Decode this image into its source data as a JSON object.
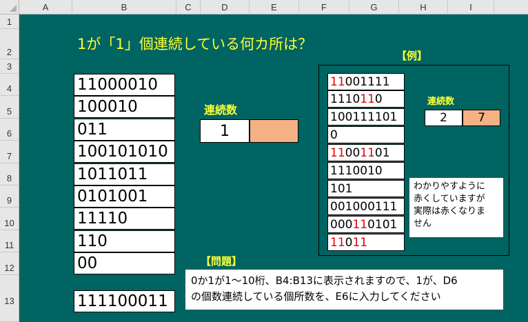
{
  "columns": [
    "A",
    "B",
    "C",
    "D",
    "E",
    "F",
    "G",
    "H",
    "I"
  ],
  "rows": [
    "1",
    "2",
    "3",
    "4",
    "5",
    "6",
    "7",
    "8",
    "9",
    "10",
    "11",
    "12",
    "13"
  ],
  "title": "1が「1」個連続している何カ所は？",
  "input": {
    "label": "連続数",
    "d6_value": "1",
    "e6_value": ""
  },
  "b_values": [
    "11000010",
    "100010",
    "011",
    "100101010",
    "1011011",
    "0101001",
    "11110",
    "110",
    "00",
    "111100011"
  ],
  "example": {
    "label": "【例】",
    "rows": [
      [
        {
          "t": "11",
          "r": true
        },
        {
          "t": "001111",
          "r": false
        }
      ],
      [
        {
          "t": "1110",
          "r": false
        },
        {
          "t": "11",
          "r": true
        },
        {
          "t": "0",
          "r": false
        }
      ],
      [
        {
          "t": "100111101",
          "r": false
        }
      ],
      [
        {
          "t": "0",
          "r": false
        }
      ],
      [
        {
          "t": "11",
          "r": true
        },
        {
          "t": "00",
          "r": false
        },
        {
          "t": "11",
          "r": true
        },
        {
          "t": "01",
          "r": false
        }
      ],
      [
        {
          "t": "1110010",
          "r": false
        }
      ],
      [
        {
          "t": "101",
          "r": false
        }
      ],
      [
        {
          "t": "001000111",
          "r": false
        }
      ],
      [
        {
          "t": "000",
          "r": false
        },
        {
          "t": "11",
          "r": true
        },
        {
          "t": "0101",
          "r": false
        }
      ],
      [
        {
          "t": "11",
          "r": true
        },
        {
          "t": "0",
          "r": false
        },
        {
          "t": "11",
          "r": true
        }
      ]
    ],
    "count_label": "連続数",
    "count_value": "2",
    "result_value": "7",
    "note_lines": [
      "わかりやすように",
      "赤くしていますが",
      "実際は赤くなりま",
      "せん"
    ]
  },
  "problem": {
    "label": "【問題】",
    "lines": [
      "0か1が1～10桁、B4:B13に表示されますので、1が、D6",
      "の個数連続している個所数を、E6に入力してください"
    ]
  },
  "colors": {
    "sheet_bg": "#006462",
    "title": "#ffff33",
    "highlight": "#f4b183",
    "red": "#e00000"
  }
}
